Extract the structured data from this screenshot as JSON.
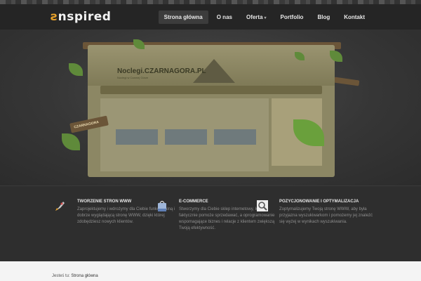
{
  "header": {
    "logo_text": "ƨnspired",
    "nav": [
      {
        "label": "Strona główna",
        "active": true
      },
      {
        "label": "O nas"
      },
      {
        "label": "Oferta",
        "has_caret": true
      },
      {
        "label": "Portfolio"
      },
      {
        "label": "Blog"
      },
      {
        "label": "Kontakt"
      }
    ]
  },
  "slider": {
    "slide_title": "Noclegi.CZARNAGORA.PL",
    "slide_subtitle": "Noclegi w Czarnej Górze",
    "sign_text": "CZARNAGORA",
    "dots_count": 5,
    "active_dot": 1
  },
  "services": [
    {
      "icon": "rocket-icon",
      "title": "Tworzenie stron www",
      "text": "Zaprojektujemy i wdrożymy dla Ciebie funkcjonalną i dobrze wyglądającą stronę WWW, dzięki której zdobędziesz nowych klientów."
    },
    {
      "icon": "shopping-bag-icon",
      "title": "E-Commerce",
      "text": "Stworzymy dla Ciebie sklep internetowy, który faktycznie pomoże sprzedawać, a oprogramowanie wspomagające biznes i relacje z klientem zwiększą Twoją efektywność."
    },
    {
      "icon": "magnifier-icon",
      "title": "Pozycjonowanie i optymalizacja",
      "text": "Zoptymalizujemy Twoją stronę WWW, aby była przyjazna wyszukiwarkom i pomożemy jej znaleźć się wyżej w wynikach wyszukiwania."
    }
  ],
  "breadcrumb": {
    "prefix": "Jesteś tu:",
    "current": "Strona główna"
  },
  "colors": {
    "accent": "#e7a12a",
    "header_bg": "#252525",
    "band_bg": "#2e2e2e"
  }
}
